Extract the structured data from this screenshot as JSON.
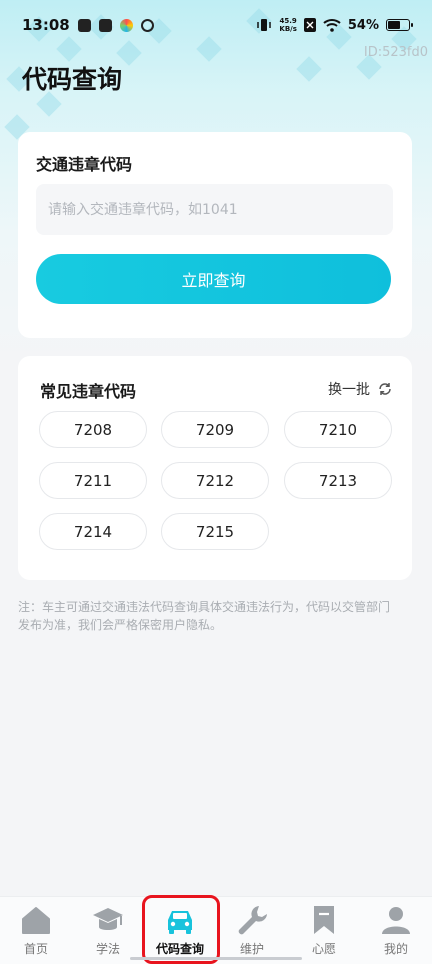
{
  "status_bar": {
    "time": "13:08",
    "net_speed_value": "45.9",
    "net_speed_unit": "KB/s",
    "battery": "54%"
  },
  "page": {
    "id_label": "ID:523fd0",
    "title": "代码查询"
  },
  "search": {
    "title": "交通违章代码",
    "placeholder": "请输入交通违章代码，如1041",
    "value": "",
    "button_label": "立即查询"
  },
  "common_codes": {
    "title": "常见违章代码",
    "refresh_label": "换一批",
    "codes": [
      "7208",
      "7209",
      "7210",
      "7211",
      "7212",
      "7213",
      "7214",
      "7215"
    ]
  },
  "note": "注：车主可通过交通违法代码查询具体交通违法行为，代码以交管部门发布为准，我们会严格保密用户隐私。",
  "tabs": [
    {
      "label": "首页",
      "icon": "home-icon"
    },
    {
      "label": "学法",
      "icon": "graduation-cap-icon"
    },
    {
      "label": "代码查询",
      "icon": "car-icon",
      "active": true
    },
    {
      "label": "维护",
      "icon": "wrench-icon"
    },
    {
      "label": "心愿",
      "icon": "bookmark-icon"
    },
    {
      "label": "我的",
      "icon": "user-icon"
    }
  ],
  "colors": {
    "accent": "#12c4de",
    "highlight_border": "#e8141e"
  }
}
